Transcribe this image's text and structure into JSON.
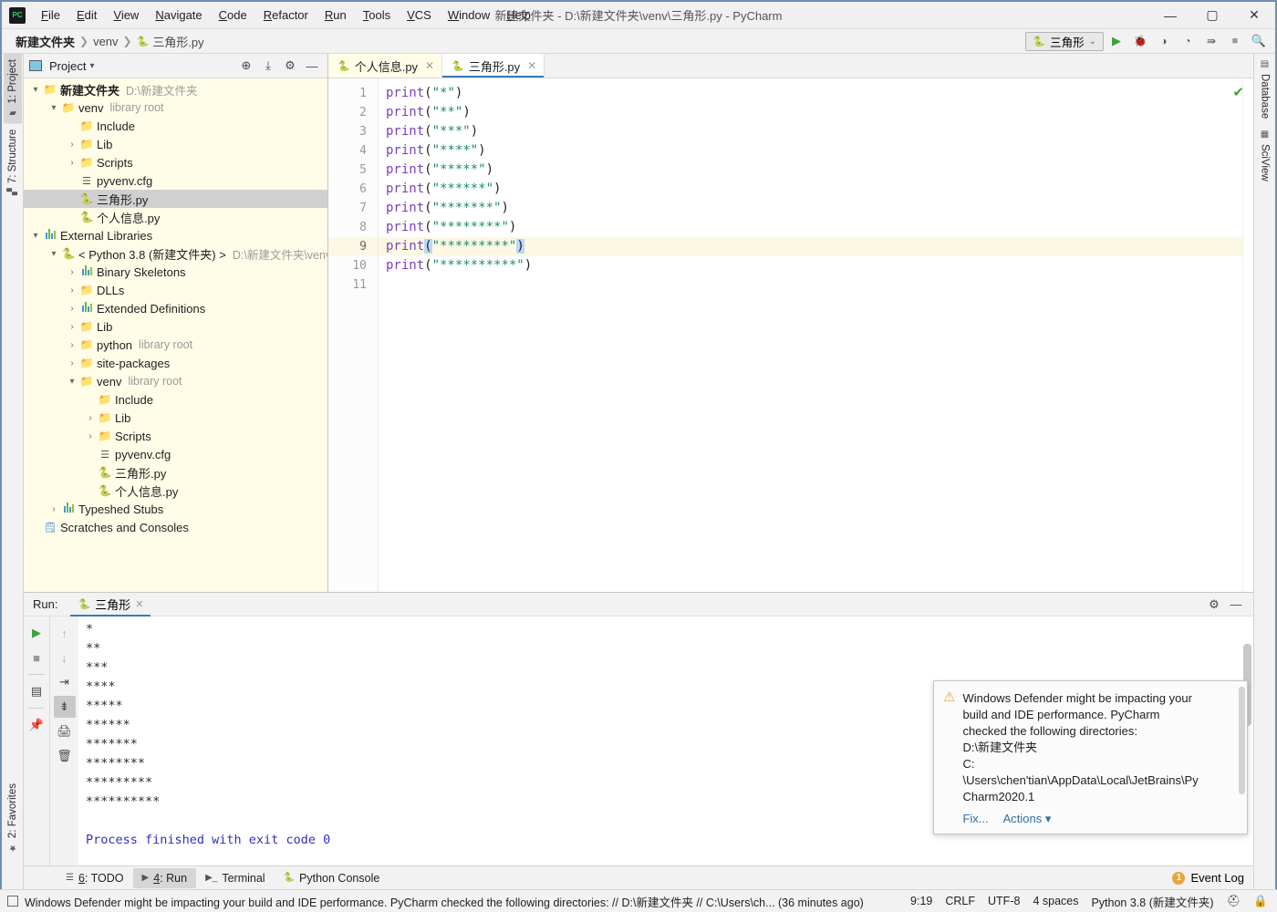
{
  "window": {
    "title": "新建文件夹 - D:\\新建文件夹\\venv\\三角形.py - PyCharm",
    "logo": "pycharm-logo",
    "minimize": "—",
    "maximize": "▢",
    "close": "✕"
  },
  "menu": {
    "items": [
      {
        "label": "File"
      },
      {
        "label": "Edit"
      },
      {
        "label": "View"
      },
      {
        "label": "Navigate"
      },
      {
        "label": "Code"
      },
      {
        "label": "Refactor"
      },
      {
        "label": "Run"
      },
      {
        "label": "Tools"
      },
      {
        "label": "VCS"
      },
      {
        "label": "Window"
      },
      {
        "label": "Help"
      }
    ]
  },
  "navbar": {
    "crumbs": [
      {
        "label": "新建文件夹",
        "bold": true
      },
      {
        "label": "venv",
        "bold": false
      },
      {
        "label": "三角形.py",
        "bold": false,
        "icon": "python-file-icon"
      }
    ],
    "separator": "❯",
    "run_config": {
      "label": "三角形",
      "icon": "python-icon",
      "chevron": "⌄"
    },
    "buttons": [
      {
        "name": "run-button",
        "glyph": "▶"
      },
      {
        "name": "debug-button",
        "glyph": "🐞"
      },
      {
        "name": "run-coverage-button",
        "glyph": "◗"
      },
      {
        "name": "profile-button",
        "glyph": "◔"
      },
      {
        "name": "run-with-console-button",
        "glyph": "≡"
      },
      {
        "name": "stop-button",
        "glyph": "■"
      },
      {
        "name": "search-everywhere-button",
        "glyph": "🔍"
      }
    ]
  },
  "left_strip": {
    "tabs": [
      {
        "label": "1: Project",
        "icon": "project-icon",
        "active": true
      },
      {
        "label": "7: Structure",
        "icon": "structure-icon",
        "active": false
      }
    ],
    "bottom_tabs": [
      {
        "label": "2: Favorites",
        "icon": "star-icon",
        "active": false
      }
    ]
  },
  "right_strip": {
    "tabs": [
      {
        "label": "Database",
        "icon": "database-icon"
      },
      {
        "label": "SciView",
        "icon": "grid-icon"
      }
    ]
  },
  "project_panel": {
    "title": "Project",
    "title_chevron": "▾",
    "buttons": [
      {
        "name": "locate-file-button",
        "glyph": "⊕"
      },
      {
        "name": "collapse-all-button",
        "glyph": "⇱"
      },
      {
        "name": "settings-gear-button",
        "glyph": "⚙"
      },
      {
        "name": "hide-panel-button",
        "glyph": "—"
      }
    ],
    "tree": [
      {
        "indent": 0,
        "arrow": "▾",
        "icon": "folder",
        "label": "新建文件夹",
        "bold": true,
        "tag": "D:\\新建文件夹"
      },
      {
        "indent": 1,
        "arrow": "▾",
        "icon": "folder",
        "label": "venv",
        "tag": "library root"
      },
      {
        "indent": 2,
        "arrow": "",
        "icon": "folder",
        "label": "Include",
        "tag": ""
      },
      {
        "indent": 2,
        "arrow": "›",
        "icon": "folder",
        "label": "Lib",
        "tag": ""
      },
      {
        "indent": 2,
        "arrow": "›",
        "icon": "folder",
        "label": "Scripts",
        "tag": ""
      },
      {
        "indent": 2,
        "arrow": "",
        "icon": "cfg",
        "label": "pyvenv.cfg",
        "tag": ""
      },
      {
        "indent": 2,
        "arrow": "",
        "icon": "python",
        "label": "三角形.py",
        "tag": "",
        "selected": true
      },
      {
        "indent": 2,
        "arrow": "",
        "icon": "python",
        "label": "个人信息.py",
        "tag": ""
      },
      {
        "indent": 0,
        "arrow": "▾",
        "icon": "lib",
        "label": "External Libraries",
        "tag": ""
      },
      {
        "indent": 1,
        "arrow": "▾",
        "icon": "pyinterp",
        "label": "< Python 3.8 (新建文件夹) >",
        "tag": "D:\\新建文件夹\\venv"
      },
      {
        "indent": 2,
        "arrow": "›",
        "icon": "lib",
        "label": "Binary Skeletons",
        "tag": ""
      },
      {
        "indent": 2,
        "arrow": "›",
        "icon": "folder",
        "label": "DLLs",
        "tag": ""
      },
      {
        "indent": 2,
        "arrow": "›",
        "icon": "lib",
        "label": "Extended Definitions",
        "tag": ""
      },
      {
        "indent": 2,
        "arrow": "›",
        "icon": "folder",
        "label": "Lib",
        "tag": ""
      },
      {
        "indent": 2,
        "arrow": "›",
        "icon": "folder",
        "label": "python",
        "tag": "library root"
      },
      {
        "indent": 2,
        "arrow": "›",
        "icon": "folder",
        "label": "site-packages",
        "tag": ""
      },
      {
        "indent": 2,
        "arrow": "▾",
        "icon": "folder",
        "label": "venv",
        "tag": "library root"
      },
      {
        "indent": 3,
        "arrow": "",
        "icon": "folder",
        "label": "Include",
        "tag": ""
      },
      {
        "indent": 3,
        "arrow": "›",
        "icon": "folder",
        "label": "Lib",
        "tag": ""
      },
      {
        "indent": 3,
        "arrow": "›",
        "icon": "folder",
        "label": "Scripts",
        "tag": ""
      },
      {
        "indent": 3,
        "arrow": "",
        "icon": "cfg",
        "label": "pyvenv.cfg",
        "tag": ""
      },
      {
        "indent": 3,
        "arrow": "",
        "icon": "python",
        "label": "三角形.py",
        "tag": ""
      },
      {
        "indent": 3,
        "arrow": "",
        "icon": "python",
        "label": "个人信息.py",
        "tag": ""
      },
      {
        "indent": 1,
        "arrow": "›",
        "icon": "lib",
        "label": "Typeshed Stubs",
        "tag": ""
      },
      {
        "indent": 0,
        "arrow": "",
        "icon": "scratch",
        "label": "Scratches and Consoles",
        "tag": ""
      }
    ]
  },
  "editor": {
    "tabs": [
      {
        "label": "个人信息.py",
        "icon": "python-file-icon",
        "active": false,
        "close": "✕"
      },
      {
        "label": "三角形.py",
        "icon": "python-file-icon",
        "active": true,
        "close": "✕"
      }
    ],
    "inspection_status": "✔",
    "current_line": 9,
    "lines": [
      {
        "no": 1,
        "fn": "print",
        "arg": "\"*\""
      },
      {
        "no": 2,
        "fn": "print",
        "arg": "\"**\""
      },
      {
        "no": 3,
        "fn": "print",
        "arg": "\"***\""
      },
      {
        "no": 4,
        "fn": "print",
        "arg": "\"****\""
      },
      {
        "no": 5,
        "fn": "print",
        "arg": "\"*****\""
      },
      {
        "no": 6,
        "fn": "print",
        "arg": "\"******\""
      },
      {
        "no": 7,
        "fn": "print",
        "arg": "\"*******\""
      },
      {
        "no": 8,
        "fn": "print",
        "arg": "\"********\""
      },
      {
        "no": 9,
        "fn": "print",
        "arg": "\"*********\""
      },
      {
        "no": 10,
        "fn": "print",
        "arg": "\"**********\""
      },
      {
        "no": 11,
        "fn": "",
        "arg": ""
      }
    ]
  },
  "run_panel": {
    "label": "Run:",
    "tab": {
      "label": "三角形",
      "icon": "python-icon",
      "close": "✕"
    },
    "header_buttons": [
      {
        "name": "settings-gear-button",
        "glyph": "⚙"
      },
      {
        "name": "hide-panel-button",
        "glyph": "—"
      }
    ],
    "toolbar_left": [
      {
        "name": "rerun-button",
        "glyph": "▶"
      },
      {
        "name": "stop-button",
        "glyph": "■"
      },
      {
        "name": "layout-button",
        "glyph": "▤"
      },
      {
        "name": "pin-tab-button",
        "glyph": "📌"
      }
    ],
    "toolbar_second": [
      {
        "name": "up-button",
        "glyph": "↑"
      },
      {
        "name": "down-button",
        "glyph": "↓"
      },
      {
        "name": "soft-wrap-button",
        "glyph": "⇥"
      },
      {
        "name": "scroll-to-end-button",
        "glyph": "⇟",
        "active": true
      },
      {
        "name": "print-button",
        "glyph": "🖨"
      },
      {
        "name": "clear-all-button",
        "glyph": "🗑"
      }
    ],
    "output": [
      "*",
      "**",
      "***",
      "****",
      "*****",
      "******",
      "*******",
      "********",
      "*********",
      "**********",
      "",
      "Process finished with exit code 0"
    ],
    "exit_line_index": 11
  },
  "balloon": {
    "icon": "warning-icon",
    "text": "Windows Defender might be impacting your build and IDE performance. PyCharm checked the following directories: D:\\新建文件夹 C: \\Users\\chen'tian\\AppData\\Local\\JetBrains\\PyCharm2020.1",
    "lines": [
      "Windows Defender might be impacting your",
      "build and IDE performance. PyCharm",
      "checked the following directories:",
      "D:\\新建文件夹",
      "C:",
      "\\Users\\chen'tian\\AppData\\Local\\JetBrains\\Py",
      "Charm2020.1"
    ],
    "links": [
      {
        "label": "Fix..."
      },
      {
        "label": "Actions ▾"
      }
    ]
  },
  "bottom_tabs": {
    "tabs": [
      {
        "label": "6: TODO",
        "icon": "todo-icon",
        "active": false
      },
      {
        "label": "4: Run",
        "icon": "run-icon",
        "active": true
      },
      {
        "label": "Terminal",
        "icon": "terminal-icon",
        "active": false
      },
      {
        "label": "Python Console",
        "icon": "python-icon",
        "active": false
      }
    ],
    "event_log": {
      "label": "Event Log",
      "count": "1"
    }
  },
  "statusbar": {
    "message": "Windows Defender might be impacting your build and IDE performance. PyCharm checked the following directories: // D:\\新建文件夹 // C:\\Users\\ch... (36 minutes ago)",
    "caret": "9:19",
    "line_separator": "CRLF",
    "encoding": "UTF-8",
    "indent": "4 spaces",
    "interpreter": "Python 3.8 (新建文件夹)",
    "icons": [
      {
        "name": "hector-inspection-icon",
        "glyph": "⛑"
      },
      {
        "name": "lock-icon",
        "glyph": "🔒"
      }
    ]
  },
  "colors": {
    "accent": "#3b7ab5",
    "panel_bg": "#fffde7",
    "keyword": "#7a3fbf",
    "string": "#1a8a6e",
    "exit_text": "#3030c0",
    "warning": "#e8a33d",
    "selection": "#d0d0d0",
    "bracket_highlight": "#bcd7f5"
  }
}
